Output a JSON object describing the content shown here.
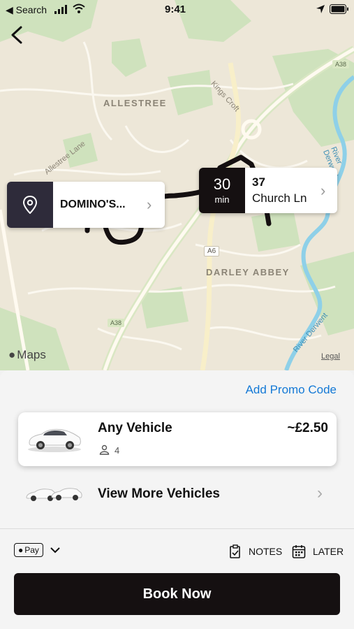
{
  "status_bar": {
    "back_label": "◀ Search",
    "time": "9:41"
  },
  "map": {
    "labels": {
      "allestree": "ALLESTREE",
      "kings_croft": "Kings Croft",
      "allestree_lane": "Allestree Lane",
      "darley_abbey": "DARLEY ABBEY",
      "river_derwent_1": "River Derwent",
      "river_derwent_2": "River Derwent",
      "a6": "A6",
      "a38_top": "A38",
      "a38_bottom": "A38"
    },
    "attribution": "Maps",
    "legal": "Legal"
  },
  "pickup": {
    "label": "DOMINO'S..."
  },
  "destination": {
    "eta_value": "30",
    "eta_unit": "min",
    "line1": "37",
    "line2": "Church Ln"
  },
  "promo": {
    "label": "Add Promo Code"
  },
  "vehicle": {
    "name": "Any Vehicle",
    "price": "~£2.50",
    "seats": "4"
  },
  "more": {
    "label": "View More Vehicles"
  },
  "options": {
    "payment": "Pay",
    "notes": "NOTES",
    "later": "LATER"
  },
  "book": {
    "label": "Book Now"
  },
  "colors": {
    "brand_dark": "#151011",
    "link_blue": "#1479d6",
    "river": "#8ed0e8",
    "park": "#cfe2bd"
  }
}
